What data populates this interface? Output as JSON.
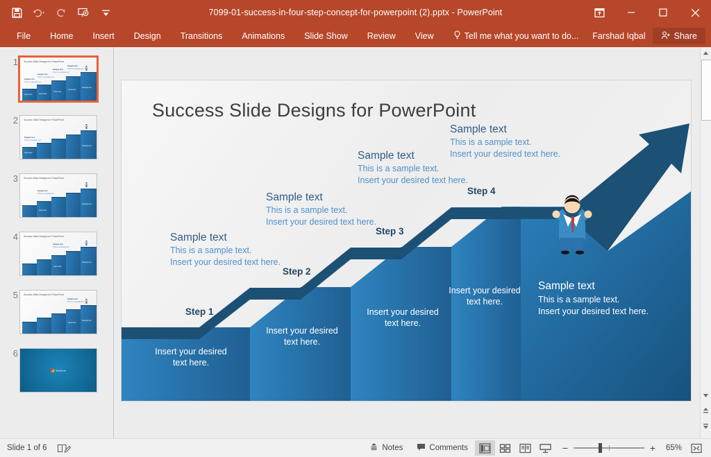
{
  "window": {
    "title": "7099-01-success-in-four-step-concept-for-powerpoint (2).pptx - PowerPoint",
    "quick_access": [
      {
        "name": "save-button",
        "label": "Save"
      },
      {
        "name": "undo-button",
        "label": "Undo"
      },
      {
        "name": "redo-button",
        "label": "Redo"
      },
      {
        "name": "start-presentation-button",
        "label": "Start From Beginning"
      },
      {
        "name": "customize-quick-access-toolbar-button",
        "label": "Customize Quick Access Toolbar"
      }
    ],
    "controls": {
      "ribbon_display_options": "Ribbon Display Options",
      "minimize": "Minimize",
      "restore": "Restore Down",
      "close": "Close"
    }
  },
  "ribbon": {
    "tabs": [
      "File",
      "Home",
      "Insert",
      "Design",
      "Transitions",
      "Animations",
      "Slide Show",
      "Review",
      "View"
    ],
    "tellme": "Tell me what you want to do...",
    "username": "Farshad Iqbal",
    "share_label": "Share"
  },
  "thumbnails": {
    "slides": [
      {
        "number": "1",
        "title": "Success Slide Designs for PowerPoint",
        "selected": true
      },
      {
        "number": "2",
        "title": "Success Slide Designs for PowerPoint",
        "selected": false
      },
      {
        "number": "3",
        "title": "Success Slide Designs for PowerPoint",
        "selected": false
      },
      {
        "number": "4",
        "title": "Success Slide Designs for PowerPoint",
        "selected": false
      },
      {
        "number": "5",
        "title": "Success Slide Designs for PowerPoint",
        "selected": false
      },
      {
        "number": "6",
        "title": "",
        "selected": false
      }
    ],
    "logo_text": "SlideModel"
  },
  "slide": {
    "title": "Success Slide Designs for PowerPoint",
    "callouts": [
      {
        "heading": "Sample text",
        "line1": "This is a sample text.",
        "line2": "Insert your desired text here."
      },
      {
        "heading": "Sample text",
        "line1": "This is a sample text.",
        "line2": "Insert your desired text here."
      },
      {
        "heading": "Sample text",
        "line1": "This is a sample text.",
        "line2": "Insert your desired text here."
      },
      {
        "heading": "Sample text",
        "line1": "This is a sample text.",
        "line2": "Insert your desired text here."
      }
    ],
    "steps": [
      {
        "label": "Step 1",
        "body1": "Insert your desired",
        "body2": "text here."
      },
      {
        "label": "Step 2",
        "body1": "Insert your desired",
        "body2": "text here."
      },
      {
        "label": "Step 3",
        "body1": "Insert your desired",
        "body2": "text here."
      },
      {
        "label": "Step 4",
        "body1": "Insert your desired",
        "body2": "text here."
      }
    ],
    "final": {
      "heading": "Sample text",
      "line1": "This is a sample text.",
      "line2": "Insert your desired text here."
    },
    "colors": {
      "step_fill_light": "#2d7cb8",
      "step_fill_dark": "#1d5d8f",
      "step_edge": "#1b4a6b",
      "callout_heading": "#2e5c86",
      "callout_body": "#5190c9",
      "step_label": "#1f4763"
    }
  },
  "statusbar": {
    "slide_counter": "Slide 1 of 6",
    "spellcheck_label": "Spell Check",
    "notes_label": "Notes",
    "comments_label": "Comments",
    "views": [
      {
        "name": "normal-view-button",
        "label": "Normal",
        "active": true
      },
      {
        "name": "slide-sorter-view-button",
        "label": "Slide Sorter",
        "active": false
      },
      {
        "name": "reading-view-button",
        "label": "Reading View",
        "active": false
      },
      {
        "name": "slide-show-button",
        "label": "Slide Show",
        "active": false
      }
    ],
    "zoom_out_label": "−",
    "zoom_in_label": "+",
    "zoom_level": "65%",
    "fit_label": "Fit slide to current window"
  },
  "theme": {
    "accent": "#b7472a",
    "accent_dark": "#a03e25"
  }
}
